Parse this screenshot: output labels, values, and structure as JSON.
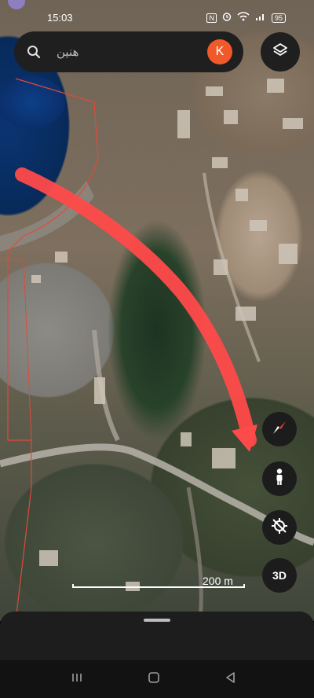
{
  "status": {
    "time": "15:03",
    "nfc": "N",
    "battery": "95"
  },
  "search": {
    "query": "هنين",
    "avatar_letter": "K"
  },
  "controls": {
    "threeD_label": "3D"
  },
  "scale": {
    "label": "200 m"
  },
  "colors": {
    "annotation_arrow": "#ff4a4a",
    "boundary_line": "#e04a3a",
    "avatar": "#f2592a",
    "compass_red": "#e53935"
  },
  "icons": [
    "search-icon",
    "layers-icon",
    "compass-icon",
    "pegman-icon",
    "recenter-icon",
    "back-icon",
    "home-icon",
    "recents-icon"
  ]
}
